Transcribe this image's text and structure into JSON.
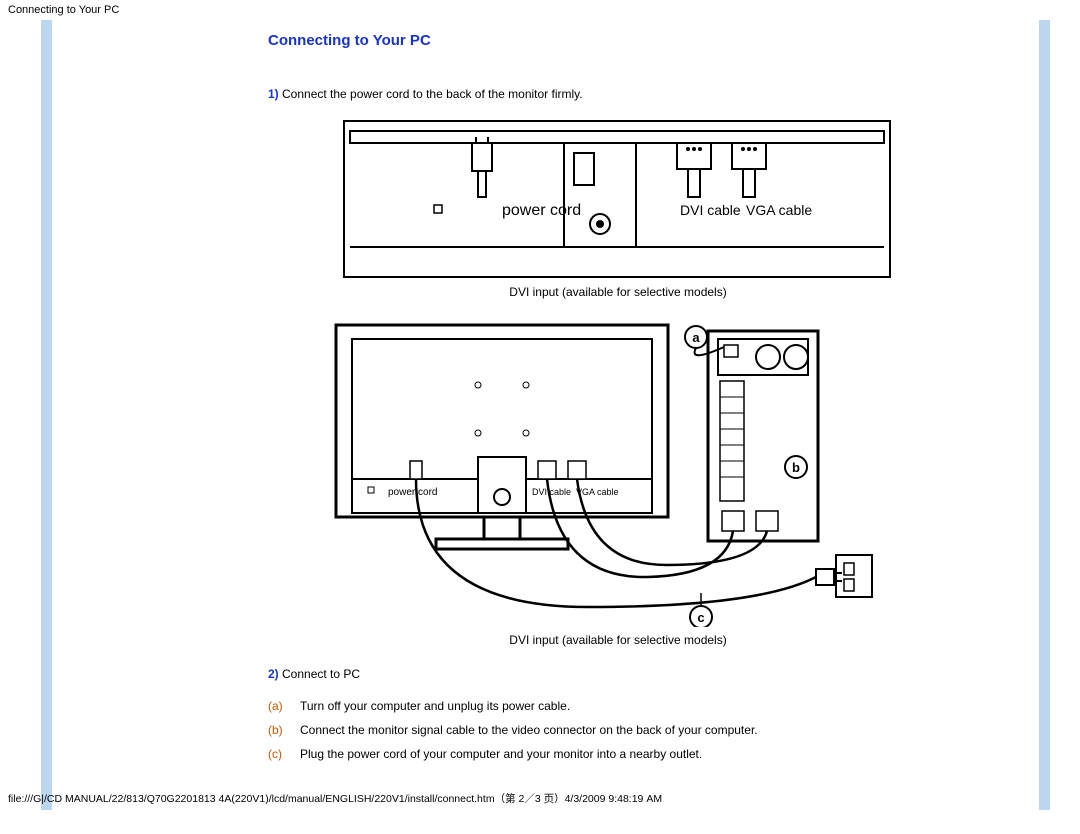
{
  "header": {
    "title": "Connecting to Your PC"
  },
  "main": {
    "title": "Connecting to Your PC",
    "step1": {
      "num": "1)",
      "text": "Connect the power cord to the back of the monitor firmly."
    },
    "fig1": {
      "label_power": "power cord",
      "label_dvi": "DVI cable",
      "label_vga": "VGA cable"
    },
    "caption1": "DVI input (available for selective models)",
    "fig2": {
      "label_power": "power cord",
      "label_dvi": "DVI cable",
      "label_vga": "VGA cable",
      "marker_a": "a",
      "marker_b": "b",
      "marker_c": "c"
    },
    "caption2": "DVI input (available for selective models)",
    "step2": {
      "num": "2)",
      "text": "Connect to PC"
    },
    "substeps": [
      {
        "mark": "(a)",
        "text": "Turn off your computer and unplug its power cable."
      },
      {
        "mark": "(b)",
        "text": "Connect the monitor signal cable to the video connector on the back of your computer."
      },
      {
        "mark": "(c)",
        "text": "Plug the power cord of your computer and your monitor into a nearby outlet."
      }
    ]
  },
  "footer": {
    "text": "file:///G|/CD MANUAL/22/813/Q70G2201813 4A(220V1)/lcd/manual/ENGLISH/220V1/install/connect.htm（第 2／3 页）4/3/2009 9:48:19 AM"
  }
}
